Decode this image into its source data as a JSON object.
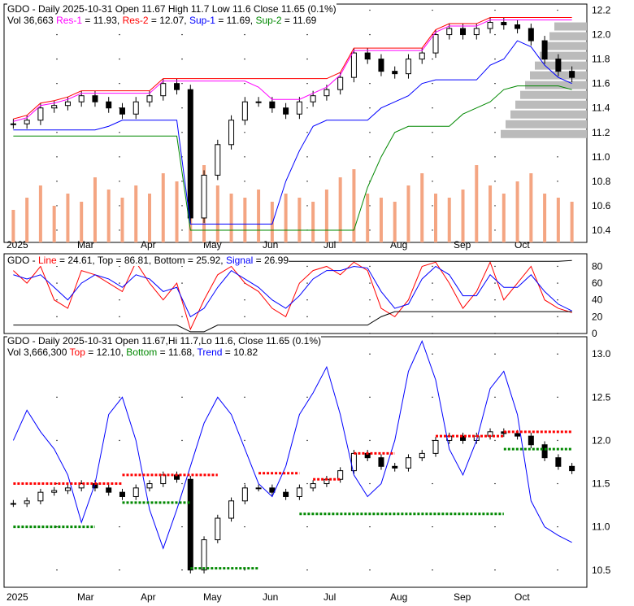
{
  "panel1": {
    "line1": "GDO - Daily 2025-10-31 Open 11.67  High 11.7  Low 11.6  Close 11.65 (0.1%)",
    "vol": "Vol 36,663",
    "res1_label": "Res-1",
    "res1_val": " = 11.93, ",
    "res2_label": "Res-2",
    "res2_val": " = 12.07, ",
    "sup1_label": "Sup-1",
    "sup1_val": " = 11.69, ",
    "sup2_label": "Sup-2",
    "sup2_val": " = 11.69"
  },
  "panel2": {
    "prefix": "GDO - ",
    "line_label": "Line",
    "line_val": " = 24.61, Top = 86.81, Bottom = 25.92, ",
    "signal_label": "Signal",
    "signal_val": " = 26.99"
  },
  "panel3": {
    "line1": "GDO - Daily 2025-10-31 Open 11.67,Hi 11.7,Lo 11.6, Close 11.65 (0.1%)",
    "vol": "Vol 3,666,300 ",
    "top_label": "Top",
    "top_val": " = 12.10, ",
    "bottom_label": "Bottom",
    "bottom_val": " = 11.68, ",
    "trend_label": "Trend",
    "trend_val": " = 10.82"
  },
  "chart_data": [
    {
      "type": "candlestick",
      "title": "GDO - Daily",
      "x_labels": [
        "2025",
        "Mar",
        "Apr",
        "May",
        "Jun",
        "Jul",
        "Aug",
        "Sep",
        "Oct"
      ],
      "y_ticks": [
        "12.2",
        "12.0",
        "11.8",
        "11.6",
        "11.4",
        "11.2",
        "11.0",
        "10.8",
        "10.6",
        "10.4"
      ],
      "ylim": [
        10.3,
        12.25
      ],
      "close": [
        11.27,
        11.3,
        11.4,
        11.42,
        11.45,
        11.5,
        11.45,
        11.4,
        11.35,
        11.45,
        11.5,
        11.6,
        11.55,
        10.5,
        10.85,
        11.1,
        11.3,
        11.45,
        11.45,
        11.4,
        11.35,
        11.45,
        11.5,
        11.55,
        11.65,
        11.85,
        11.8,
        11.7,
        11.68,
        11.8,
        11.85,
        12.0,
        12.05,
        12.0,
        12.05,
        12.1,
        12.08,
        12.05,
        11.95,
        11.8,
        11.7,
        11.65
      ],
      "volume": [
        40,
        55,
        70,
        45,
        60,
        50,
        80,
        65,
        55,
        70,
        60,
        85,
        75,
        100,
        95,
        70,
        60,
        55,
        65,
        50,
        60,
        55,
        50,
        65,
        80,
        90,
        60,
        55,
        50,
        70,
        85,
        60,
        55,
        65,
        95,
        70,
        60,
        75,
        85,
        60,
        55,
        50
      ]
    },
    {
      "type": "line",
      "y_ticks": [
        "80",
        "60",
        "40",
        "20",
        "0"
      ],
      "ylim": [
        0,
        95
      ],
      "series": [
        {
          "name": "Line",
          "values": [
            75,
            60,
            80,
            40,
            30,
            75,
            70,
            60,
            50,
            85,
            60,
            40,
            60,
            5,
            40,
            70,
            80,
            60,
            50,
            30,
            20,
            60,
            75,
            80,
            70,
            85,
            75,
            30,
            20,
            40,
            80,
            85,
            60,
            30,
            50,
            85,
            40,
            60,
            80,
            40,
            30,
            25
          ]
        },
        {
          "name": "Signal",
          "values": [
            70,
            65,
            70,
            55,
            40,
            60,
            70,
            65,
            55,
            70,
            65,
            50,
            55,
            20,
            30,
            55,
            75,
            65,
            55,
            40,
            30,
            45,
            65,
            75,
            75,
            80,
            78,
            50,
            30,
            35,
            65,
            80,
            70,
            45,
            45,
            70,
            55,
            55,
            70,
            50,
            35,
            27
          ]
        },
        {
          "name": "Top",
          "values": [
            86,
            86,
            86,
            86,
            86,
            86,
            86,
            86,
            86,
            86,
            86,
            86,
            86,
            86,
            86,
            86,
            86,
            86,
            86,
            86,
            86,
            86,
            86,
            86,
            86,
            86,
            86,
            86,
            86,
            86,
            86,
            86,
            86,
            86,
            86,
            86,
            86,
            86,
            86,
            86,
            86,
            87
          ]
        },
        {
          "name": "Bottom",
          "values": [
            10,
            10,
            10,
            10,
            10,
            10,
            10,
            10,
            10,
            10,
            10,
            10,
            10,
            2,
            2,
            10,
            10,
            10,
            10,
            10,
            10,
            10,
            10,
            10,
            10,
            10,
            10,
            20,
            26,
            26,
            26,
            26,
            26,
            26,
            26,
            26,
            26,
            26,
            26,
            26,
            26,
            26
          ]
        }
      ]
    },
    {
      "type": "candlestick",
      "y_ticks": [
        "13.0",
        "12.5",
        "12.0",
        "11.5",
        "11.0",
        "10.5"
      ],
      "ylim": [
        10.3,
        13.2
      ],
      "trend": [
        12.0,
        12.35,
        12.1,
        11.9,
        11.6,
        11.05,
        11.5,
        12.3,
        12.5,
        12.0,
        11.2,
        10.75,
        11.2,
        11.7,
        12.2,
        12.5,
        12.3,
        11.9,
        11.5,
        11.35,
        11.7,
        12.3,
        12.55,
        12.85,
        12.3,
        11.6,
        11.35,
        11.5,
        12.0,
        12.8,
        13.15,
        12.7,
        11.9,
        11.6,
        12.0,
        12.6,
        12.8,
        12.3,
        11.3,
        11.0,
        10.9,
        10.82
      ],
      "resistance": [
        [
          0,
          8,
          11.5
        ],
        [
          8,
          15,
          11.6
        ],
        [
          18,
          21,
          11.62
        ],
        [
          22,
          24,
          11.55
        ],
        [
          25,
          28,
          11.85
        ],
        [
          31,
          36,
          12.05
        ],
        [
          36,
          41,
          12.1
        ]
      ],
      "support": [
        [
          0,
          6,
          11.0
        ],
        [
          8,
          13,
          11.28
        ],
        [
          13,
          18,
          10.52
        ],
        [
          21,
          36,
          11.15
        ],
        [
          36,
          41,
          11.9
        ]
      ]
    }
  ]
}
